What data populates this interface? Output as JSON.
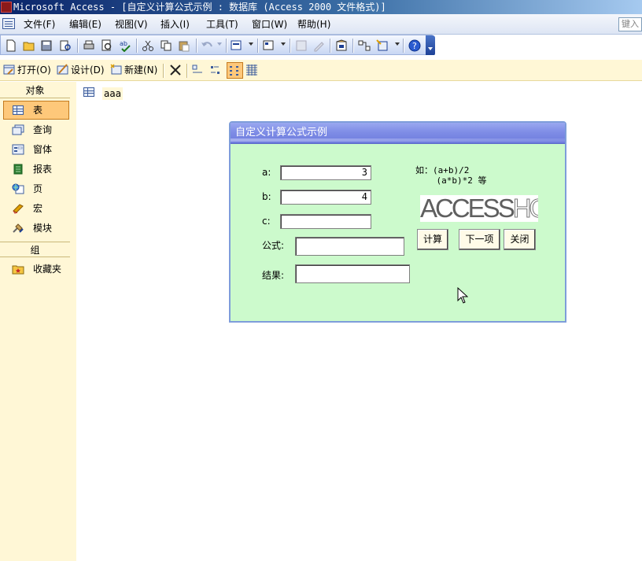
{
  "window": {
    "title": "Microsoft Access - [自定义计算公式示例 : 数据库 (Access 2000 文件格式)]"
  },
  "menubar": {
    "items": [
      "文件(F)",
      "编辑(E)",
      "视图(V)",
      "插入(I)",
      "工具(T)",
      "窗口(W)",
      "帮助(H)"
    ],
    "help_box_text": "键入"
  },
  "database_toolbar": {
    "open_label": "打开(O)",
    "design_label": "设计(D)",
    "new_label": "新建(N)"
  },
  "objects_pane": {
    "header": "对象",
    "items": [
      {
        "label": "表",
        "icon": "table-icon",
        "active": true
      },
      {
        "label": "查询",
        "icon": "query-icon",
        "active": false
      },
      {
        "label": "窗体",
        "icon": "form-icon",
        "active": false
      },
      {
        "label": "报表",
        "icon": "report-icon",
        "active": false
      },
      {
        "label": "页",
        "icon": "page-icon",
        "active": false
      },
      {
        "label": "宏",
        "icon": "macro-icon",
        "active": false
      },
      {
        "label": "模块",
        "icon": "module-icon",
        "active": false
      }
    ],
    "group_header": "组",
    "favorites_label": "收藏夹"
  },
  "object_list": {
    "entries": [
      "aaa"
    ]
  },
  "dialog": {
    "title": "自定义计算公式示例",
    "fields": {
      "a_label": "a:",
      "a_value": "3",
      "b_label": "b:",
      "b_value": "4",
      "c_label": "c:",
      "c_value": "",
      "formula_label": "公式:",
      "formula_value": "",
      "result_label": "结果:",
      "result_value": ""
    },
    "hint_line1": "如：(a+b)/2",
    "hint_line2": "    (a*b)*2 等",
    "logo_part1": "ACCESS",
    "logo_part2": "HOME",
    "buttons": {
      "calculate": "计算",
      "next": "下一项",
      "close": "关闭"
    }
  },
  "colors": {
    "dialog_background": "#ccfacc",
    "dialog_title": "#7f8de6",
    "pane_background": "#fff7d6",
    "active_item": "#fec87a"
  }
}
